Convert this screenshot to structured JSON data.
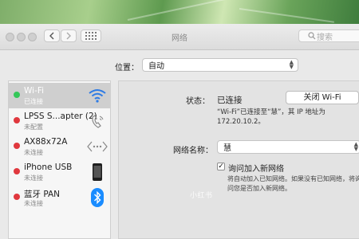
{
  "window": {
    "title": "网络"
  },
  "toolbar": {
    "back_icon": "chevron-left-icon",
    "forward_icon": "chevron-right-icon",
    "grid_icon": "show-all-grid-icon",
    "search_placeholder": "搜索"
  },
  "location": {
    "label": "位置：",
    "value": "自动"
  },
  "services": [
    {
      "name": "Wi-Fi",
      "status": "已连接",
      "dot": "#34c759",
      "icon": "wifi-icon",
      "selected": true
    },
    {
      "name": "LPSS S...apter (2)",
      "status": "未配置",
      "dot": "#e0383e",
      "icon": "phone-icon",
      "selected": false
    },
    {
      "name": "AX88x72A",
      "status": "未连接",
      "dot": "#e0383e",
      "icon": "ethernet-icon",
      "selected": false
    },
    {
      "name": "iPhone USB",
      "status": "未连接",
      "dot": "#e0383e",
      "icon": "iphone-icon",
      "selected": false
    },
    {
      "name": "蓝牙 PAN",
      "status": "未连接",
      "dot": "#e0383e",
      "icon": "bluetooth-icon",
      "selected": false
    }
  ],
  "detail": {
    "status_label": "状态：",
    "status_value": "已连接",
    "toggle_button": "关闭 Wi-Fi",
    "status_desc": "“Wi-Fi”已连接至“慧”，其 IP 地址为 172.20.10.2。",
    "network_name_label": "网络名称：",
    "network_name_value": "慧",
    "ask_join_label": "询问加入新网络",
    "ask_join_checked": true,
    "ask_join_note": "将自动加入已知网络。如果没有已知网络，将询问您是否加入新网络。"
  },
  "watermark": "小红书",
  "colors": {
    "selected_bg": "#cfcfcf",
    "green": "#34c759",
    "red": "#e0383e",
    "bluetooth": "#1a8cff"
  }
}
